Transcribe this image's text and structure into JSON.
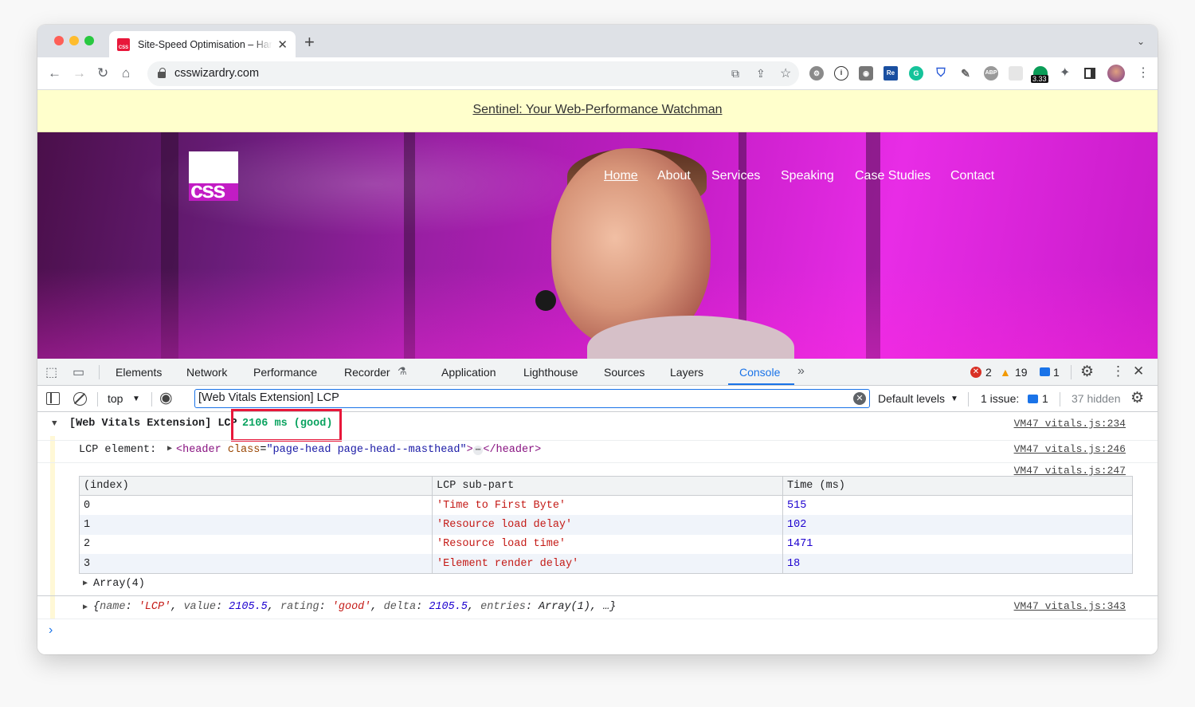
{
  "browser": {
    "tab_title": "Site-Speed Optimisation – Harry Roberts",
    "favicon_text": "CSS",
    "url": "csswizardry.com",
    "extension_badge": "3.33",
    "extension_labels": {
      "re": "Re",
      "abp": "ABP"
    }
  },
  "site": {
    "banner_link": "Sentinel: Your Web-Performance Watchman",
    "logo_text": "css",
    "nav": [
      "Home",
      "About",
      "Services",
      "Speaking",
      "Case Studies",
      "Contact"
    ]
  },
  "devtools": {
    "tabs": [
      "Elements",
      "Network",
      "Performance",
      "Recorder",
      "Application",
      "Lighthouse",
      "Sources",
      "Layers",
      "Console"
    ],
    "active_tab": "Console",
    "errors": "2",
    "warnings": "19",
    "infos": "1",
    "context": "top",
    "filter_value": "[Web Vitals Extension] LCP",
    "levels": "Default levels",
    "issues_label": "1 issue:",
    "issues_count": "1",
    "hidden": "37 hidden"
  },
  "console": {
    "group_prefix": "[Web Vitals Extension] LCP",
    "group_value": "2106 ms (good)",
    "group_link": "VM47 vitals.js:234",
    "element_label": "LCP element:",
    "element_tag_open": "<header",
    "element_attr": "class",
    "element_attr_val": "\"page-head  page-head--masthead\"",
    "element_tag_close": "</header>",
    "element_link": "VM47 vitals.js:246",
    "table_link": "VM47 vitals.js:247",
    "table_headers": [
      "(index)",
      "LCP sub-part",
      "Time (ms)"
    ],
    "table_rows": [
      [
        "0",
        "'Time to First Byte'",
        "515"
      ],
      [
        "1",
        "'Resource load delay'",
        "102"
      ],
      [
        "2",
        "'Resource load time'",
        "1471"
      ],
      [
        "3",
        "'Element render delay'",
        "18"
      ]
    ],
    "array_label": "Array(4)",
    "object_parts": {
      "open": "{",
      "k1": "name",
      "v1": "'LCP'",
      "k2": "value",
      "v2": "2105.5",
      "k3": "rating",
      "v3": "'good'",
      "k4": "delta",
      "v4": "2105.5",
      "k5": "entries",
      "v5": "Array(1)",
      "close": ", …}"
    },
    "object_link": "VM47 vitals.js:343",
    "prompt": "›"
  }
}
